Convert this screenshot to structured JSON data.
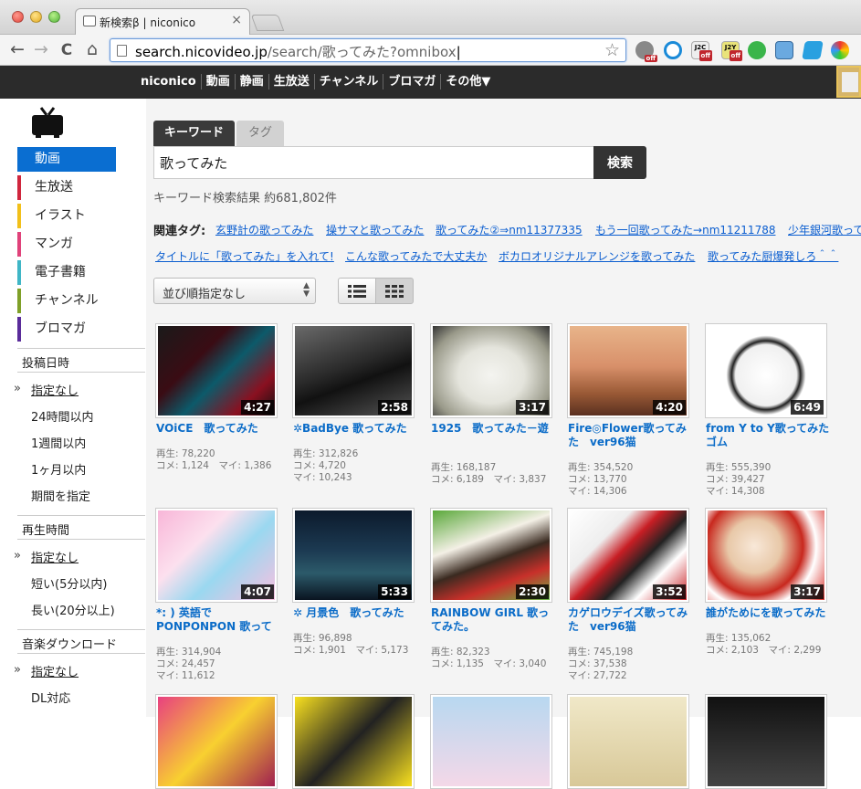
{
  "browser": {
    "tab_title": "新検索β | niconico",
    "close_glyph": "×",
    "url_host": "search.nicovideo.jp",
    "url_rest": "/search/歌ってみた?omnibox",
    "back_glyph": "←",
    "forward_glyph": "→",
    "reload_glyph": "C",
    "home_glyph": "⌂",
    "star_glyph": "☆",
    "ext_badge": "off",
    "ext_labels": [
      "J2C",
      "J2Y"
    ]
  },
  "nicobar": {
    "items": [
      "niconico",
      "動画",
      "静画",
      "生放送",
      "チャンネル",
      "ブロマガ",
      "その他▼"
    ]
  },
  "sidebar": {
    "categories": [
      {
        "label": "動画",
        "color": "#0a6ed1"
      },
      {
        "label": "生放送",
        "color": "#d0263d"
      },
      {
        "label": "イラスト",
        "color": "#f2c01a"
      },
      {
        "label": "マンガ",
        "color": "#e0427a"
      },
      {
        "label": "電子書籍",
        "color": "#3fb6c6"
      },
      {
        "label": "チャンネル",
        "color": "#7fa028"
      },
      {
        "label": "ブロマガ",
        "color": "#5a2c9a"
      }
    ],
    "post_date_heading": "投稿日時",
    "post_date_options": [
      "指定なし",
      "24時間以内",
      "1週間以内",
      "1ヶ月以内",
      "期間を指定"
    ],
    "duration_heading": "再生時間",
    "duration_options": [
      "指定なし",
      "短い(5分以内)",
      "長い(20分以上)"
    ],
    "music_heading": "音楽ダウンロード",
    "music_options": [
      "指定なし",
      "DL対応"
    ],
    "arrow_glyph": "»"
  },
  "search": {
    "tab_keyword": "キーワード",
    "tab_tag": "タグ",
    "query": "歌ってみた",
    "button": "検索",
    "result_count": "キーワード検索結果 約681,802件"
  },
  "related": {
    "label": "関連タグ:",
    "tags": [
      "玄野計の歌ってみた",
      "操サマと歌ってみた",
      "歌ってみた②⇒nm11377335",
      "もう一回歌ってみた→nm11211788",
      "少年銀河歌ってみた",
      "タイトルに「歌ってみた」を入れて!",
      "こんな歌ってみたで大丈夫か",
      "ボカロオリジナルアレンジを歌ってみた",
      "歌ってみた厨爆発しろ＾＾"
    ]
  },
  "sort": {
    "selected": "並び順指定なし",
    "arrows": "▲▼"
  },
  "videos": [
    {
      "title": "VOiCE　歌ってみた",
      "duration": "4:27",
      "views": "再生: 78,220",
      "comments": "コメ: 1,124",
      "mylist": "マイ: 1,386"
    },
    {
      "title": "✲BadBye 歌ってみた",
      "duration": "2:58",
      "views": "再生: 312,826",
      "comments": "コメ: 4,720",
      "mylist": "マイ: 10,243"
    },
    {
      "title": "1925　歌ってみた－遊",
      "duration": "3:17",
      "views": "再生: 168,187",
      "comments": "コメ: 6,189",
      "mylist": "マイ: 3,837"
    },
    {
      "title": "Fire◎Flower歌ってみた　ver96猫",
      "duration": "4:20",
      "views": "再生: 354,520",
      "comments": "コメ: 13,770",
      "mylist": "マイ: 14,306"
    },
    {
      "title": "from Y to Y歌ってみたゴム",
      "duration": "6:49",
      "views": "再生: 555,390",
      "comments": "コメ: 39,427",
      "mylist": "マイ: 14,308"
    },
    {
      "title": "*: ) 英語で PONPONPON 歌って",
      "duration": "4:07",
      "views": "再生: 314,904",
      "comments": "コメ: 24,457",
      "mylist": "マイ: 11,612"
    },
    {
      "title": "✲ 月景色　歌ってみた",
      "duration": "5:33",
      "views": "再生: 96,898",
      "comments": "コメ: 1,901",
      "mylist": "マイ: 5,173"
    },
    {
      "title": "RAINBOW GIRL 歌ってみた。",
      "duration": "2:30",
      "views": "再生: 82,323",
      "comments": "コメ: 1,135",
      "mylist": "マイ: 3,040"
    },
    {
      "title": "カゲロウデイズ歌ってみた　ver96猫",
      "duration": "3:52",
      "views": "再生: 745,198",
      "comments": "コメ: 37,538",
      "mylist": "マイ: 27,722"
    },
    {
      "title": "誰がためにを歌ってみた",
      "duration": "3:17",
      "views": "再生: 135,062",
      "comments": "コメ: 2,103",
      "mylist": "マイ: 2,299"
    }
  ]
}
